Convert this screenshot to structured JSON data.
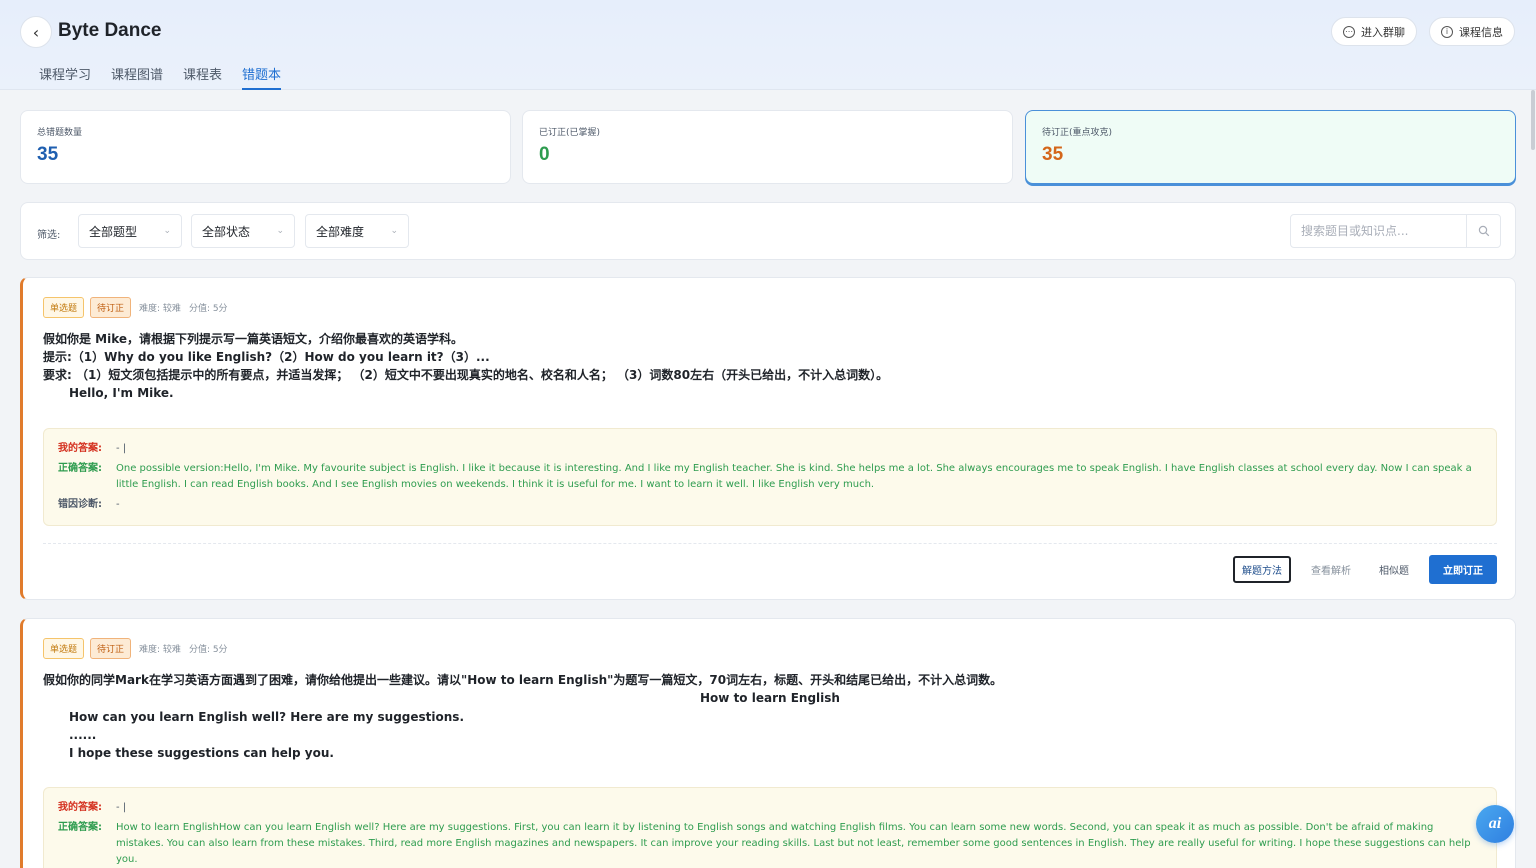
{
  "header": {
    "title": "Byte Dance",
    "tabs": [
      {
        "label": "课程学习"
      },
      {
        "label": "课程图谱"
      },
      {
        "label": "课程表"
      },
      {
        "label": "错题本"
      }
    ],
    "active_tab": "错题本",
    "join_chat_label": "进入群聊",
    "course_info_label": "课程信息"
  },
  "stats": [
    {
      "label": "总错题数量",
      "value": "35",
      "color": "#1f5fb0"
    },
    {
      "label": "已订正(已掌握)",
      "value": "0",
      "color": "#2e9c4f"
    },
    {
      "label": "待订正(重点攻克)",
      "value": "35",
      "color": "#d4661a"
    }
  ],
  "filter": {
    "label": "筛选:",
    "type_select": "全部题型",
    "status_select": "全部状态",
    "difficulty_select": "全部难度",
    "search_placeholder": "搜索题目或知识点..."
  },
  "labels": {
    "my_answer": "我的答案:",
    "correct_answer": "正确答案:",
    "diagnosis": "错因诊断:"
  },
  "actions": {
    "method": "解题方法",
    "analysis": "查看解析",
    "similar": "相似题",
    "correct_now": "立即订正"
  },
  "questions": [
    {
      "type": "单选题",
      "status": "待订正",
      "difficulty": "难度: 较难",
      "score": "分值: 5分",
      "lines": [
        "假如你是 Mike，请根据下列提示写一篇英语短文，介绍你最喜欢的英语学科。",
        "提示:（1）Why do you like English?（2）How do you learn it?（3）...",
        "要求: （1）短文须包括提示中的所有要点，并适当发挥； （2）短文中不要出现真实的地名、校名和人名； （3）词数80左右（开头已给出，不计入总词数）。",
        "Hello, I'm Mike."
      ],
      "my_answer": "- |",
      "correct_answer": "One possible version:Hello, I'm Mike. My favourite subject is English. I like it because it is interesting. And I like my English teacher. She is kind. She helps me a lot. She always encourages me to speak English. I have English classes at school every day. Now I can speak a little English. I can read English books. And I see English movies on weekends. I think it is useful for me. I want to learn it well. I like English very much.",
      "diagnosis": "-"
    },
    {
      "type": "单选题",
      "status": "待订正",
      "difficulty": "难度: 较难",
      "score": "分值: 5分",
      "lines": [
        "假如你的同学Mark在学习英语方面遇到了困难，请你给他提出一些建议。请以\"How to learn English\"为题写一篇短文，70词左右，标题、开头和结尾已给出，不计入总词数。",
        "How to learn English",
        "How can you learn English well? Here are my suggestions.",
        "......",
        "I hope these suggestions can help you."
      ],
      "my_answer": "- |",
      "correct_answer": "How to learn EnglishHow can you learn English well? Here are my suggestions. First, you can learn it by listening to English songs and watching English films. You can learn some new words. Second, you can speak it as much as possible. Don't be afraid of making mistakes. You can also learn from these mistakes. Third, read more English magazines and newspapers. It can improve your reading skills. Last but not least, remember some good sentences in English. They are really useful for writing. I hope these suggestions can help you.",
      "diagnosis": "-"
    }
  ],
  "assistant_icon": "ai-assistant-icon"
}
